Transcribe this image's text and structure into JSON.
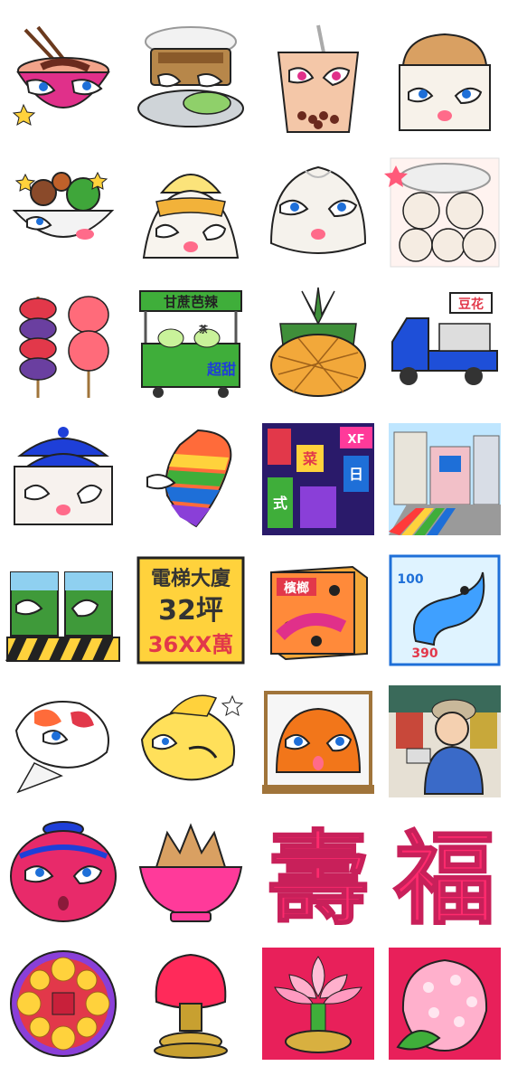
{
  "grid": {
    "columns": 4,
    "rows": 8,
    "stickers": [
      {
        "id": "beef-noodle-bowl"
      },
      {
        "id": "stinky-tofu-plate"
      },
      {
        "id": "bubble-tea-cup"
      },
      {
        "id": "toast-box"
      },
      {
        "id": "braised-food-bowl"
      },
      {
        "id": "shaved-ice-mountain"
      },
      {
        "id": "steamed-bun"
      },
      {
        "id": "soup-dumplings"
      },
      {
        "id": "candied-fruit-skewers"
      },
      {
        "id": "sugarcane-juice-cart",
        "sign": "甘蔗芭辣",
        "badge": "超甜",
        "sub": "茶"
      },
      {
        "id": "pineapple"
      },
      {
        "id": "blue-truck",
        "sign": "豆花"
      },
      {
        "id": "memorial-hall"
      },
      {
        "id": "rainbow-taiwan-map"
      },
      {
        "id": "neon-city-signs",
        "signs": [
          "XF",
          "菜",
          "日",
          "式"
        ]
      },
      {
        "id": "street-crossing-building"
      },
      {
        "id": "green-mountain-barrier"
      },
      {
        "id": "real-estate-sign",
        "line1": "電梯大廈",
        "line2": "32坪",
        "line3": "36XX萬"
      },
      {
        "id": "betel-nut-box",
        "sign": "檳榔"
      },
      {
        "id": "blue-dolphin-poster",
        "top": "100",
        "bottom": "390"
      },
      {
        "id": "koi-fish"
      },
      {
        "id": "yellow-fish"
      },
      {
        "id": "lion-dog-display-case"
      },
      {
        "id": "market-street-boy"
      },
      {
        "id": "red-lantern"
      },
      {
        "id": "mooncake-bowl"
      },
      {
        "id": "longevity-character",
        "char": "壽"
      },
      {
        "id": "blessing-character",
        "char": "福"
      },
      {
        "id": "flower-wreath"
      },
      {
        "id": "peach-on-stand"
      },
      {
        "id": "lotus-lamp"
      },
      {
        "id": "pink-peach"
      }
    ]
  },
  "colors": {
    "accent": "#ff2a6d",
    "outline": "#222222",
    "background": "#ffffff"
  }
}
